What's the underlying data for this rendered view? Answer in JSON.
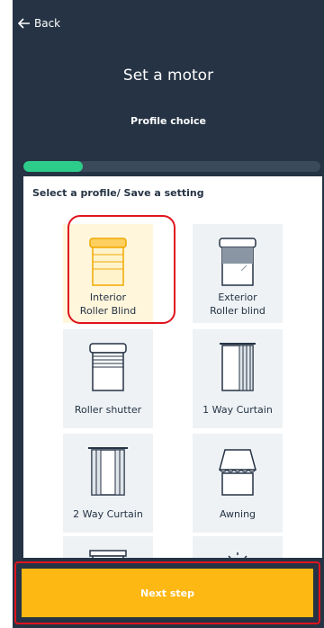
{
  "header": {
    "back_label": "Back",
    "title": "Set a motor",
    "subtitle": "Profile choice"
  },
  "progress": {
    "fraction": 0.2
  },
  "card": {
    "heading": "Select a profile/ Save a setting"
  },
  "profiles": [
    {
      "label": "Interior Roller Blind",
      "label_lines": [
        "Interior",
        "Roller Blind"
      ],
      "icon": "interior-roller-blind-icon",
      "selected": true
    },
    {
      "label": "Exterior Roller blind",
      "label_lines": [
        "Exterior",
        "Roller blind"
      ],
      "icon": "exterior-roller-blind-icon",
      "selected": false
    },
    {
      "label": "Roller shutter",
      "label_lines": [
        "Roller shutter"
      ],
      "icon": "roller-shutter-icon",
      "selected": false
    },
    {
      "label": "1 Way Curtain",
      "label_lines": [
        "1 Way Curtain"
      ],
      "icon": "one-way-curtain-icon",
      "selected": false
    },
    {
      "label": "2 Way Curtain",
      "label_lines": [
        "2 Way Curtain"
      ],
      "icon": "two-way-curtain-icon",
      "selected": false
    },
    {
      "label": "Awning",
      "label_lines": [
        "Awning"
      ],
      "icon": "awning-icon",
      "selected": false
    },
    {
      "label": "",
      "label_lines": [],
      "icon": "venetian-blind-icon",
      "selected": false
    },
    {
      "label": "",
      "label_lines": [],
      "icon": "light-bulb-icon",
      "selected": false
    }
  ],
  "footer": {
    "next_label": "Next step"
  },
  "colors": {
    "background": "#253344",
    "accent": "#fdb813",
    "progress": "#2ecc8a",
    "highlight": "#e0141e"
  }
}
